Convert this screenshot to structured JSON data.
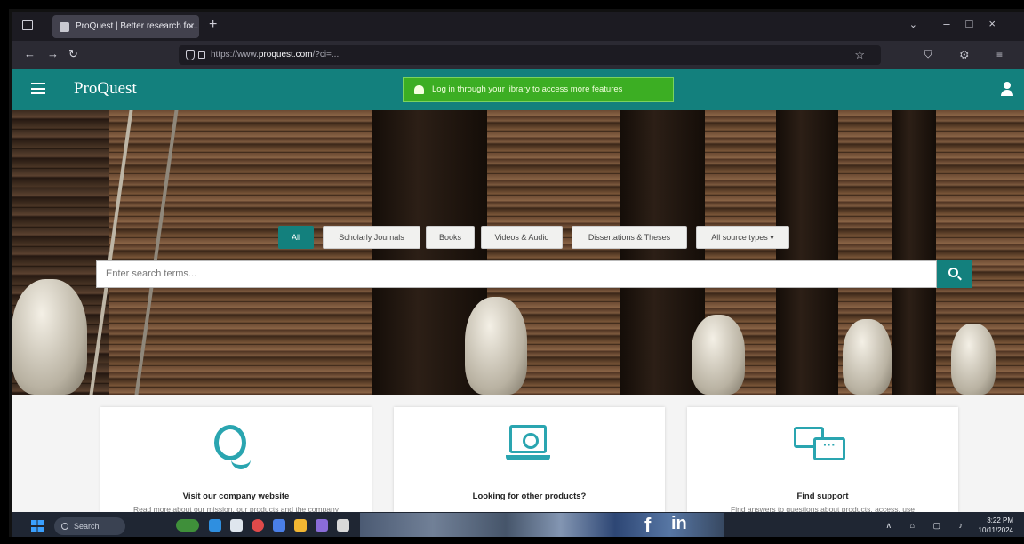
{
  "browser": {
    "tab_title": "ProQuest | Better research for...",
    "tab_close": "×",
    "new_tab": "+",
    "back": "←",
    "forward": "→",
    "reload": "↻",
    "url_prefix": "https://www.",
    "url_host": "proquest.com",
    "url_path": "/?ci=...",
    "star": "☆",
    "window_controls": "–□×",
    "toolbar_icons": "⛉ ⚙ ≡"
  },
  "site": {
    "logo": "ProQuest",
    "login_banner": "Log in through your library to access more features",
    "colors": {
      "header": "#13807d",
      "banner": "#3cae23",
      "accent": "#2aa5b0"
    }
  },
  "search": {
    "filters": [
      {
        "label": "All",
        "active": true
      },
      {
        "label": "Scholarly Journals",
        "active": false
      },
      {
        "label": "Books",
        "active": false
      },
      {
        "label": "Videos & Audio",
        "active": false
      },
      {
        "label": "Dissertations & Theses",
        "active": false
      },
      {
        "label": "All source types ▾",
        "active": false
      }
    ],
    "placeholder": "Enter search terms..."
  },
  "cards": [
    {
      "title": "Visit our company website",
      "desc": "Read more about our mission, our products and the company",
      "icon": "q-logo-icon"
    },
    {
      "title": "Looking for other products?",
      "desc": "",
      "icon": "laptop-search-icon"
    },
    {
      "title": "Find support",
      "desc": "Find answers to questions about products, access, use",
      "icon": "chat-bubbles-icon"
    }
  ],
  "taskbar": {
    "search_label": "Search",
    "tray": "∧ ⌂ ▢ ♪",
    "time": "3:22 PM",
    "date": "10/11/2024",
    "social_f": "f",
    "social_in": "in"
  }
}
